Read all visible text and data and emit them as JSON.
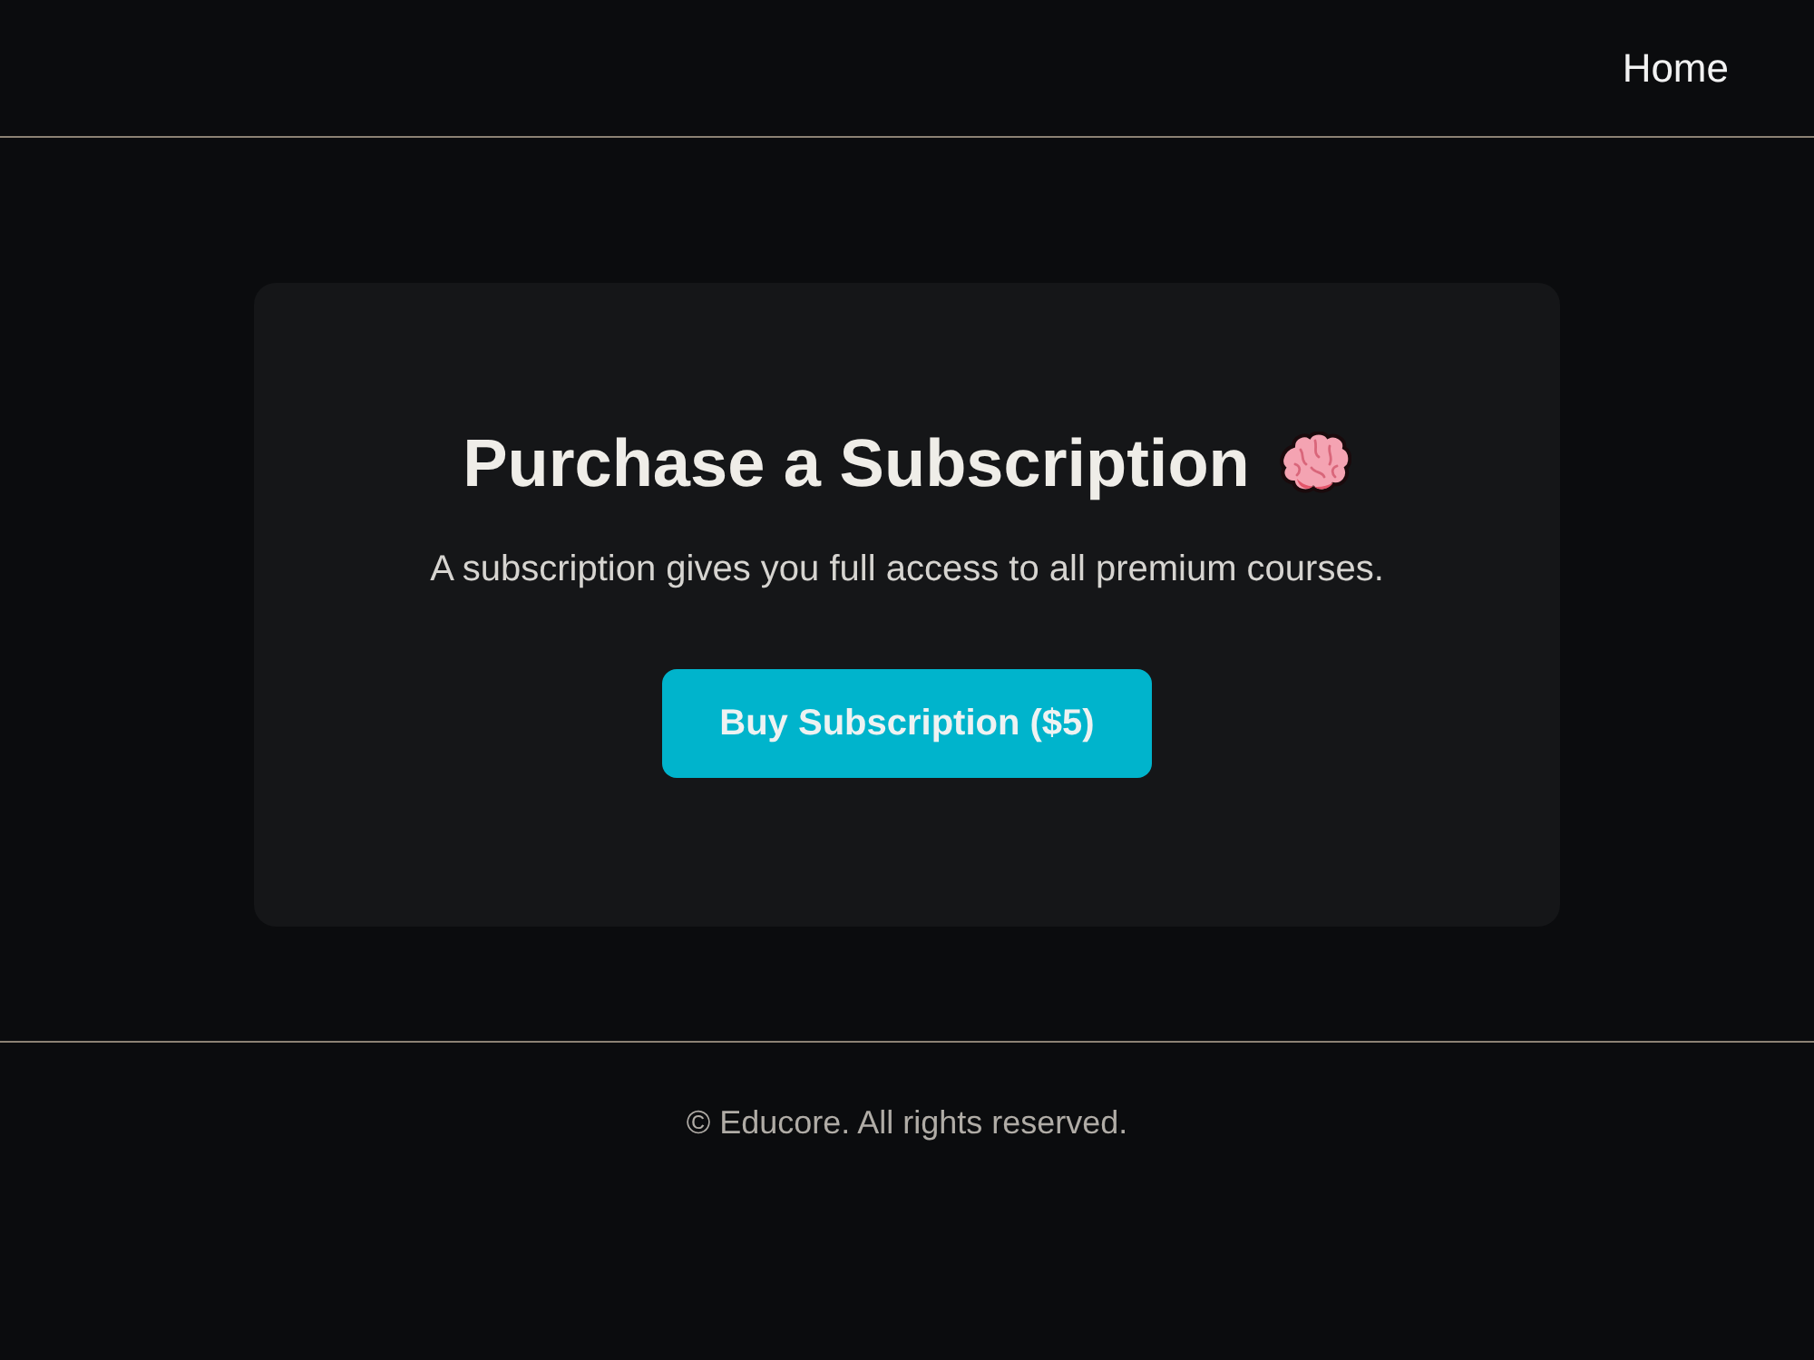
{
  "nav": {
    "links": [
      "Home"
    ]
  },
  "card": {
    "title": "Purchase a Subscription",
    "description": "A subscription gives you full access to all premium courses.",
    "button": "Buy Subscription ($5)"
  },
  "footer": {
    "text": "© Educore. All rights reserved."
  }
}
